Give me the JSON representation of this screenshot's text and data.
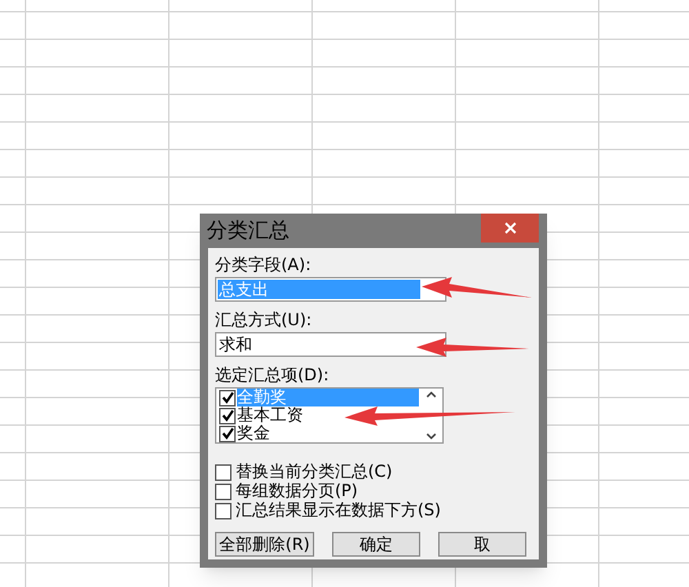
{
  "dialog": {
    "title": "分类汇总",
    "fields": [
      {
        "label": "分类字段(A):",
        "value": "总支出",
        "selected": true
      },
      {
        "label": "汇总方式(U):",
        "value": "求和",
        "selected": false
      }
    ],
    "items_label": "选定汇总项(D):",
    "items": [
      {
        "label": "全勤奖",
        "checked": true,
        "selected": true
      },
      {
        "label": "基本工资",
        "checked": true,
        "selected": false
      },
      {
        "label": "奖金",
        "checked": true,
        "selected": false
      }
    ],
    "options": [
      {
        "label": "替换当前分类汇总(C)",
        "checked": false
      },
      {
        "label": "每组数据分页(P)",
        "checked": false
      },
      {
        "label": "汇总结果显示在数据下方(S)",
        "checked": false
      }
    ],
    "buttons": [
      "全部删除(R)",
      "确定",
      "取"
    ]
  }
}
